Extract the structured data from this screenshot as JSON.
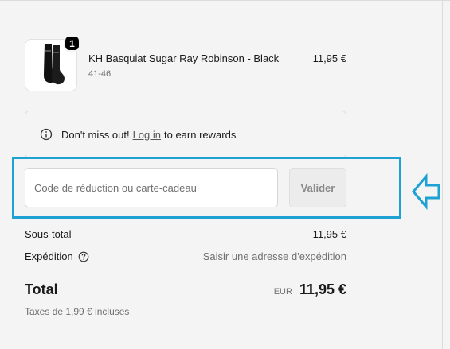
{
  "product": {
    "name": "KH Basquiat Sugar Ray Robinson - Black",
    "variant": "41-46",
    "price": "11,95 €",
    "quantity": "1",
    "thumb_icon": "sock-pair-icon"
  },
  "rewards": {
    "text_before": "Don't miss out!",
    "link_label": "Log in",
    "text_after": "to earn rewards",
    "icon": "info-icon"
  },
  "discount": {
    "placeholder": "Code de réduction ou carte-cadeau",
    "value": "",
    "apply_label": "Valider"
  },
  "summary": {
    "subtotal_label": "Sous-total",
    "subtotal_value": "11,95 €",
    "shipping_label": "Expédition",
    "shipping_value": "Saisir une adresse d'expédition",
    "total_label": "Total",
    "total_currency": "EUR",
    "total_value": "11,95 €",
    "taxes_note": "Taxes de 1,99 € incluses"
  },
  "annotation": {
    "highlight_color": "#1ea1d3",
    "arrow_icon": "left-arrow-icon"
  }
}
